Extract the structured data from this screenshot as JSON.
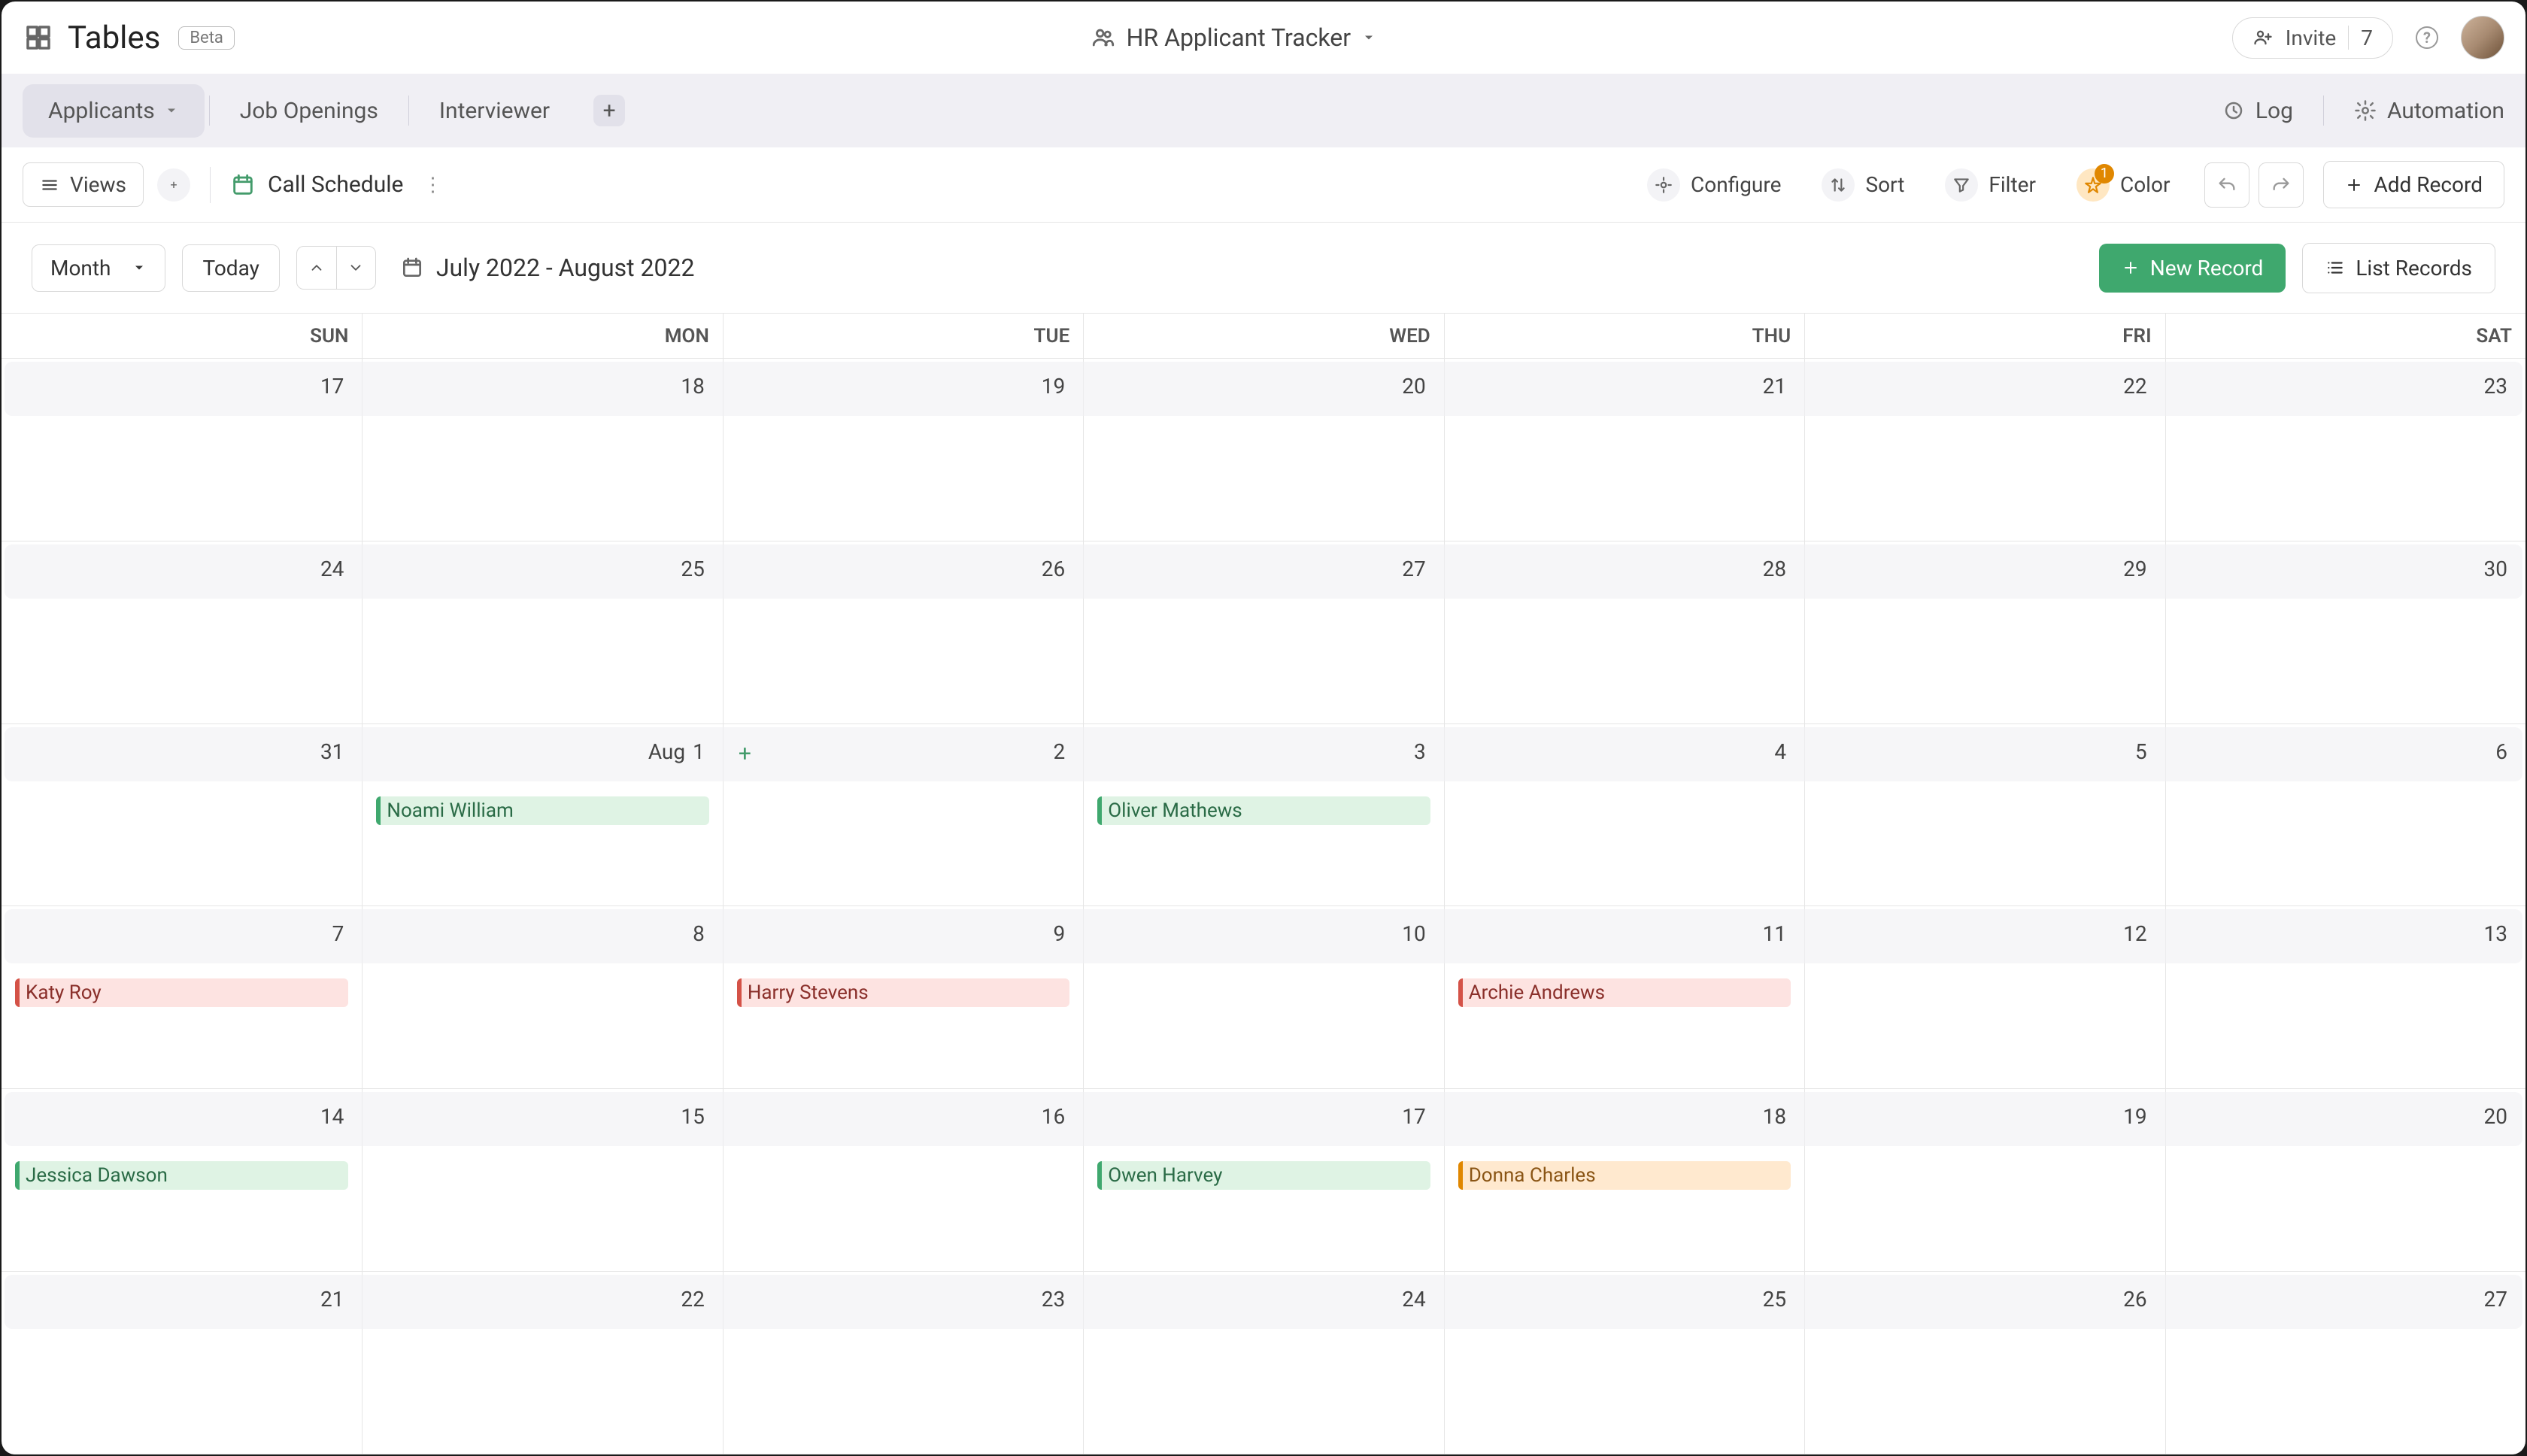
{
  "brand": {
    "name": "Tables",
    "badge": "Beta"
  },
  "header": {
    "title": "HR Applicant Tracker"
  },
  "invite": {
    "label": "Invite",
    "count": "7"
  },
  "tabs": {
    "items": [
      {
        "label": "Applicants",
        "active": true
      },
      {
        "label": "Job Openings",
        "active": false
      },
      {
        "label": "Interviewer",
        "active": false
      }
    ],
    "log": "Log",
    "automation": "Automation"
  },
  "viewbar": {
    "views": "Views",
    "view_name": "Call Schedule",
    "configure": "Configure",
    "sort": "Sort",
    "filter": "Filter",
    "color": "Color",
    "color_count": "1",
    "add_record": "Add Record"
  },
  "calendar_controls": {
    "period": "Month",
    "today": "Today",
    "range": "July 2022 - August 2022",
    "new_record": "New Record",
    "list_records": "List Records"
  },
  "dow": [
    "SUN",
    "MON",
    "TUE",
    "WED",
    "THU",
    "FRI",
    "SAT"
  ],
  "weeks": [
    [
      {
        "num": "17"
      },
      {
        "num": "18"
      },
      {
        "num": "19"
      },
      {
        "num": "20"
      },
      {
        "num": "21"
      },
      {
        "num": "22"
      },
      {
        "num": "23"
      }
    ],
    [
      {
        "num": "24"
      },
      {
        "num": "25"
      },
      {
        "num": "26"
      },
      {
        "num": "27"
      },
      {
        "num": "28"
      },
      {
        "num": "29"
      },
      {
        "num": "30"
      }
    ],
    [
      {
        "num": "31"
      },
      {
        "month": "Aug",
        "num": "1",
        "event": {
          "name": "Noami William",
          "color": "green"
        }
      },
      {
        "num": "2",
        "add_hint": true
      },
      {
        "num": "3",
        "event": {
          "name": "Oliver Mathews",
          "color": "green"
        }
      },
      {
        "num": "4"
      },
      {
        "num": "5"
      },
      {
        "num": "6"
      }
    ],
    [
      {
        "num": "7",
        "event": {
          "name": "Katy Roy",
          "color": "red"
        }
      },
      {
        "num": "8"
      },
      {
        "num": "9",
        "event": {
          "name": "Harry Stevens",
          "color": "red"
        }
      },
      {
        "num": "10"
      },
      {
        "num": "11",
        "event": {
          "name": "Archie Andrews",
          "color": "red"
        }
      },
      {
        "num": "12"
      },
      {
        "num": "13"
      }
    ],
    [
      {
        "num": "14",
        "event": {
          "name": "Jessica Dawson",
          "color": "green"
        }
      },
      {
        "num": "15"
      },
      {
        "num": "16"
      },
      {
        "num": "17",
        "event": {
          "name": "Owen Harvey",
          "color": "green"
        }
      },
      {
        "num": "18",
        "event": {
          "name": "Donna Charles",
          "color": "orange"
        }
      },
      {
        "num": "19"
      },
      {
        "num": "20"
      }
    ],
    [
      {
        "num": "21"
      },
      {
        "num": "22"
      },
      {
        "num": "23"
      },
      {
        "num": "24"
      },
      {
        "num": "25"
      },
      {
        "num": "26"
      },
      {
        "num": "27"
      }
    ]
  ],
  "colors": {
    "accent_green": "#3fa86e",
    "accent_orange": "#e08700",
    "accent_red": "#d45247"
  }
}
